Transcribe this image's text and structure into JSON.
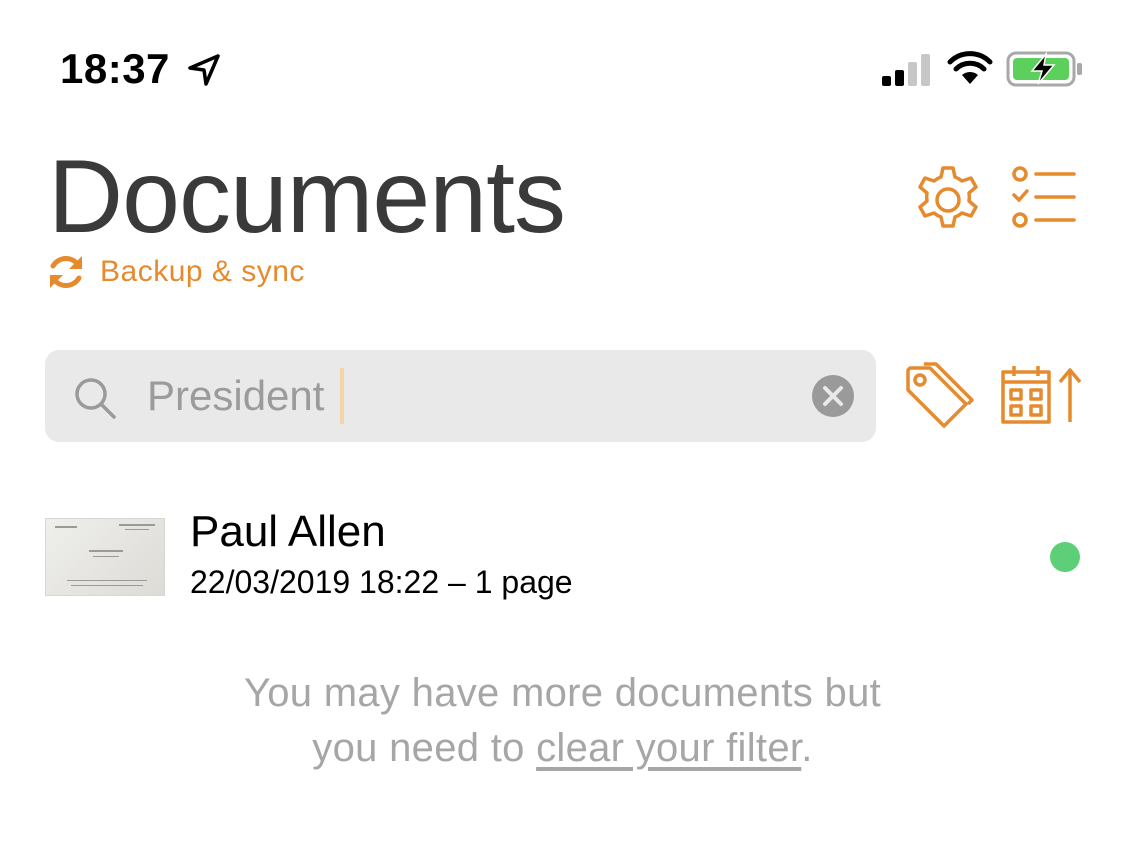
{
  "status_bar": {
    "time": "18:37",
    "icons": [
      "location-arrow-icon",
      "cellular-signal-icon",
      "wifi-icon",
      "battery-charging-icon"
    ]
  },
  "header": {
    "title": "Documents",
    "sync_label": "Backup & sync",
    "icons": [
      "gear-icon",
      "checklist-icon",
      "sync-icon"
    ]
  },
  "search": {
    "value": "President",
    "placeholder": "",
    "icons": [
      "search-icon",
      "clear-icon",
      "tag-icon",
      "calendar-sort-icon"
    ]
  },
  "documents": [
    {
      "title": "Paul Allen",
      "meta": "22/03/2019 18:22 – 1 page",
      "thumbnail": "business-card-thumbnail",
      "status_color": "#5ccf78"
    }
  ],
  "footer": {
    "message_part1": "You may have more documents but",
    "message_part2": "you need to ",
    "link_text": "clear your filter",
    "message_end": "."
  },
  "colors": {
    "accent": "#e68a2e",
    "title": "#3a3a3a",
    "search_bg": "#e9e9ea",
    "muted_text": "#a6a6a6",
    "status_green": "#5ccf78"
  }
}
